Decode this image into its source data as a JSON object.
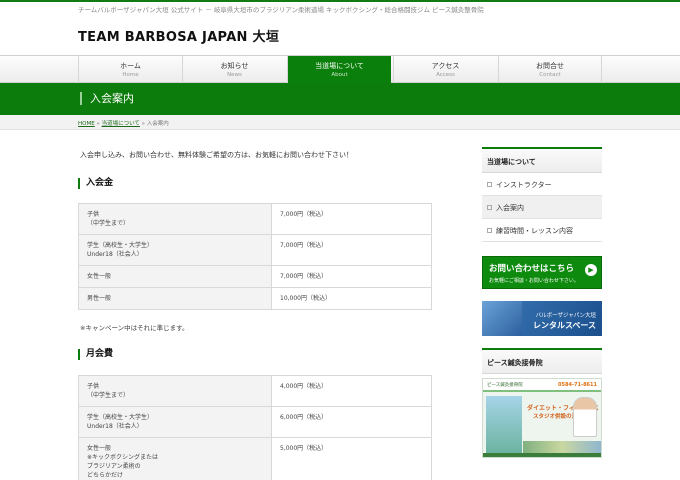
{
  "header": {
    "tagline": "チームバルボーザジャパン大垣 公式サイト － 岐阜県大垣市のブラジリアン柔術道場 キックボクシング・総合格闘技ジム ピース鍼灸整骨院",
    "site_title": "TEAM BARBOSA JAPAN 大垣"
  },
  "nav": {
    "items": [
      {
        "label": "ホーム",
        "sub": "Home"
      },
      {
        "label": "お知らせ",
        "sub": "News"
      },
      {
        "label": "当道場について",
        "sub": "About"
      },
      {
        "label": "アクセス",
        "sub": "Access"
      },
      {
        "label": "お問合せ",
        "sub": "Contact"
      }
    ],
    "active_index": 2
  },
  "page": {
    "title": "入会案内",
    "breadcrumb": {
      "home": "HOME",
      "sep1": "»",
      "parent": "当道場について",
      "sep2": "»",
      "current": "入会案内"
    },
    "intro": "入会申し込み、お問い合わせ、無料体験ご希望の方は、お気軽にお問い合わせ下さい！"
  },
  "entry_fee": {
    "heading": "入会金",
    "rows": [
      {
        "label_line1": "子供",
        "label_line2": "（中学生まで）",
        "value": "7,000円（税込）"
      },
      {
        "label_line1": "学生（高校生・大学生）",
        "label_line2": "Under18（社会人）",
        "value": "7,000円（税込）"
      },
      {
        "label_line1": "女性一般",
        "value": "7,000円（税込）"
      },
      {
        "label_line1": "男性一般",
        "value": "10,000円（税込）"
      }
    ],
    "note": "※キャンペーン中はそれに準じます。"
  },
  "monthly_fee": {
    "heading": "月会費",
    "rows": [
      {
        "label_line1": "子供",
        "label_line2": "（中学生まで）",
        "value": "4,000円（税込）"
      },
      {
        "label_line1": "学生（高校生・大学生）",
        "label_line2": "Under18（社会人）",
        "value": "6,000円（税込）"
      },
      {
        "label_line1": "女性一般",
        "label_line2": "※キックボクシングまたは",
        "label_line3": "ブラジリアン柔術の",
        "label_line4": "どちらかだけ",
        "value": "5,000円（税込）"
      }
    ]
  },
  "sidebar": {
    "about_heading": "当道場について",
    "items": [
      {
        "label": "インストラクター"
      },
      {
        "label": "入会案内"
      },
      {
        "label": "練習時間・レッスン内容"
      }
    ],
    "active_index": 1,
    "contact_banner": {
      "main": "お問い合わせはこちら",
      "sub": "お気軽にご相談・お問い合わせ下さい。",
      "arrow": "▶"
    },
    "rental_banner": {
      "sub": "バルボーザジャパン大垣",
      "main": "レンタルスペース"
    },
    "clinic_heading": "ピース鍼灸接骨院",
    "clinic_banner": {
      "top_text": "ピース鍼灸接骨院",
      "phone": "0584-71-8611",
      "promo1": "ダイエット・フィットネス",
      "promo2": "スタジオ併設の治療院"
    }
  },
  "colors": {
    "brand_green": "#0c7d0c",
    "rental_blue": "#2c5f9e"
  }
}
